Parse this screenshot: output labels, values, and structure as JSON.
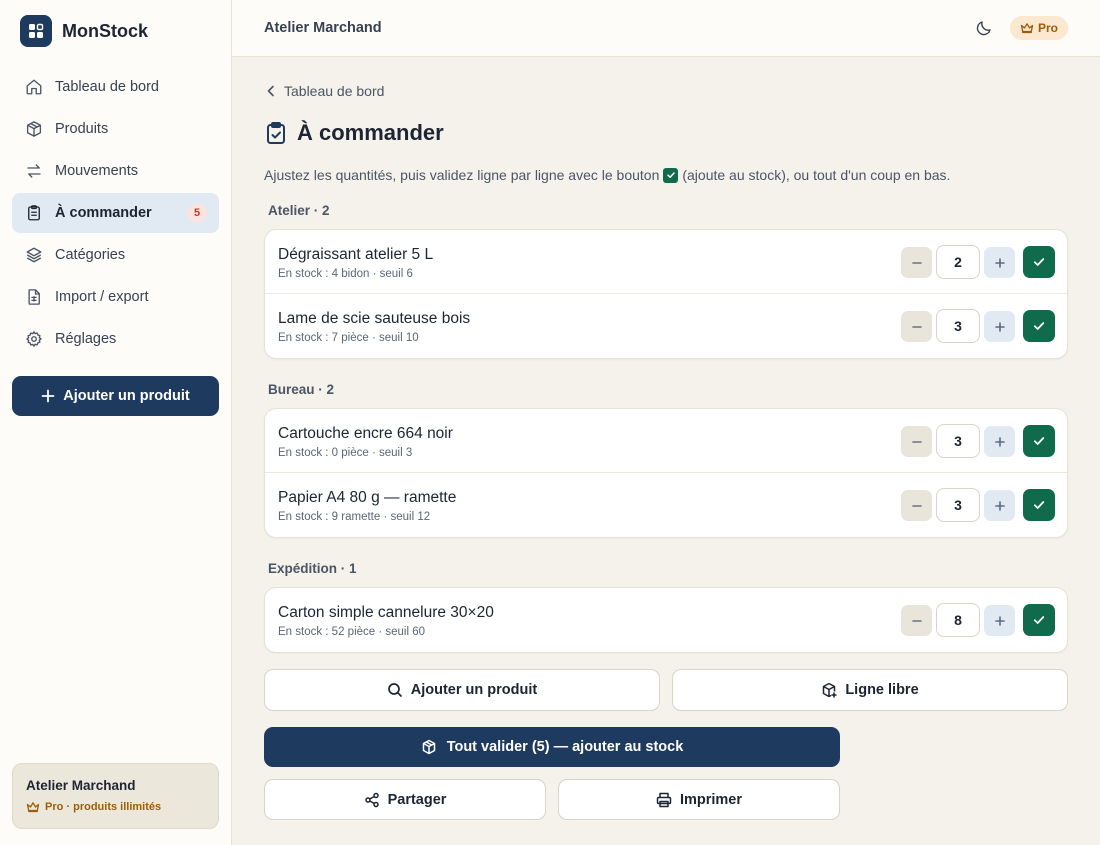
{
  "app": {
    "name": "MonStock"
  },
  "sidebar": {
    "items": [
      {
        "label": "Tableau de bord",
        "icon": "home-icon"
      },
      {
        "label": "Produits",
        "icon": "box-icon"
      },
      {
        "label": "Mouvements",
        "icon": "arrows-icon"
      },
      {
        "label": "À commander",
        "icon": "clipboard-icon",
        "badge": "5",
        "active": true
      },
      {
        "label": "Catégories",
        "icon": "layers-icon"
      },
      {
        "label": "Import / export",
        "icon": "spreadsheet-icon"
      },
      {
        "label": "Réglages",
        "icon": "gear-icon"
      }
    ],
    "add_product_label": "Ajouter un produit",
    "account": {
      "name": "Atelier Marchand",
      "plan": "Pro · produits illimités"
    }
  },
  "header": {
    "title": "Atelier Marchand",
    "plan_badge": "Pro"
  },
  "main": {
    "breadcrumb": "Tableau de bord",
    "title": "À commander",
    "instructions_before": "Ajustez les quantités, puis validez ligne par ligne avec le bouton",
    "instructions_after": "(ajoute au stock), ou tout d'un coup en bas.",
    "groups": [
      {
        "label": "Atelier · 2",
        "items": [
          {
            "name": "Dégraissant atelier 5 L",
            "meta": "En stock : 4 bidon · seuil 6",
            "qty": "2"
          },
          {
            "name": "Lame de scie sauteuse bois",
            "meta": "En stock : 7 pièce · seuil 10",
            "qty": "3"
          }
        ]
      },
      {
        "label": "Bureau · 2",
        "items": [
          {
            "name": "Cartouche encre 664 noir",
            "meta": "En stock : 0 pièce · seuil 3",
            "qty": "3"
          },
          {
            "name": "Papier A4 80 g — ramette",
            "meta": "En stock : 9 ramette · seuil 12",
            "qty": "3"
          }
        ]
      },
      {
        "label": "Expédition · 1",
        "items": [
          {
            "name": "Carton simple cannelure 30×20",
            "meta": "En stock : 52 pièce · seuil 60",
            "qty": "8"
          }
        ]
      }
    ],
    "actions": {
      "add_product": "Ajouter un produit",
      "free_line": "Ligne libre",
      "validate_all": "Tout valider (5) — ajouter au stock",
      "share": "Partager",
      "print": "Imprimer"
    }
  },
  "colors": {
    "primary": "#1f3a5f",
    "success": "#106b4c",
    "pro_accent": "#9a5d0b",
    "badge_red": "#c0392b",
    "background": "#f4f2ea"
  }
}
